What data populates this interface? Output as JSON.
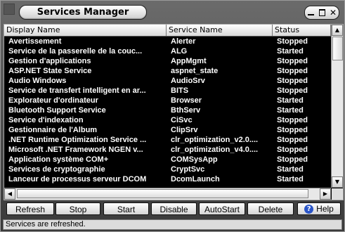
{
  "window": {
    "title": "Services Manager",
    "controls": [
      "minimize-icon",
      "maximize-icon",
      "close-icon"
    ]
  },
  "list": {
    "columns": [
      "Display Name",
      "Service Name",
      "Status"
    ],
    "rows": [
      {
        "display": "Avertissement",
        "service": "Alerter",
        "status": "Stopped"
      },
      {
        "display": "Service de la passerelle de la couc...",
        "service": "ALG",
        "status": "Started"
      },
      {
        "display": "Gestion d'applications",
        "service": "AppMgmt",
        "status": "Stopped"
      },
      {
        "display": "ASP.NET State Service",
        "service": "aspnet_state",
        "status": "Stopped"
      },
      {
        "display": "Audio Windows",
        "service": "AudioSrv",
        "status": "Stopped"
      },
      {
        "display": "Service de transfert intelligent en ar...",
        "service": "BITS",
        "status": "Stopped"
      },
      {
        "display": "Explorateur d'ordinateur",
        "service": "Browser",
        "status": "Started"
      },
      {
        "display": "Bluetooth Support Service",
        "service": "BthServ",
        "status": "Started"
      },
      {
        "display": "Service d'indexation",
        "service": "CiSvc",
        "status": "Stopped"
      },
      {
        "display": "Gestionnaire de l'Album",
        "service": "ClipSrv",
        "status": "Stopped"
      },
      {
        "display": ".NET Runtime Optimization Service ...",
        "service": "clr_optimization_v2.0....",
        "status": "Stopped"
      },
      {
        "display": "Microsoft .NET Framework NGEN v...",
        "service": "clr_optimization_v4.0....",
        "status": "Stopped"
      },
      {
        "display": "Application système COM+",
        "service": "COMSysApp",
        "status": "Stopped"
      },
      {
        "display": "Services de cryptographie",
        "service": "CryptSvc",
        "status": "Started"
      },
      {
        "display": "Lanceur de processus serveur DCOM",
        "service": "DcomLaunch",
        "status": "Started"
      }
    ]
  },
  "toolbar": {
    "refresh": "Refresh",
    "stop": "Stop",
    "start": "Start",
    "disable": "Disable",
    "autostart": "AutoStart",
    "delete": "Delete",
    "help": "Help",
    "help_icon": "?"
  },
  "status": {
    "message": "Services are refreshed."
  }
}
